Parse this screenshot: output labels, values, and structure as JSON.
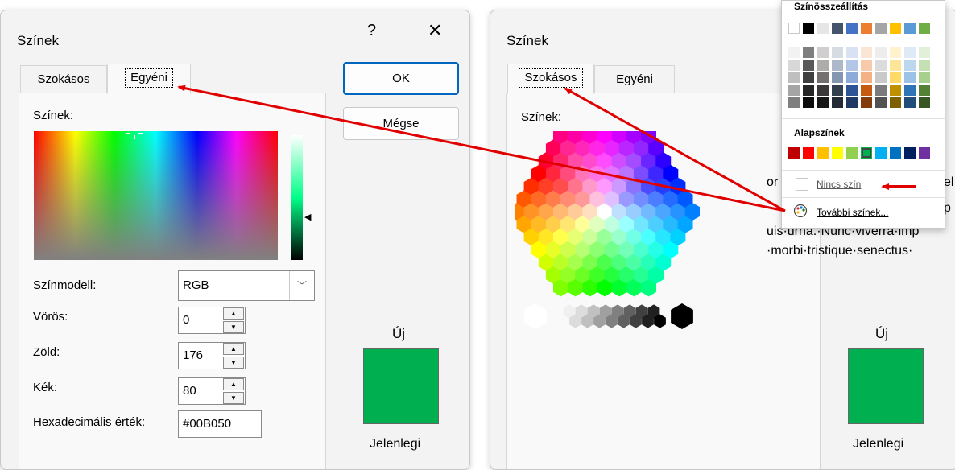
{
  "left_dialog": {
    "title": "Színek",
    "help_label": "?",
    "close_label": "✕",
    "tabs": [
      "Szokásos",
      "Egyéni"
    ],
    "colors_label": "Színek:",
    "ok_label": "OK",
    "cancel_label": "Mégse",
    "color_model_label": "Színmodell:",
    "color_model_value": "RGB",
    "red_label": "Vörös:",
    "red_value": "0",
    "green_label": "Zöld:",
    "green_value": "176",
    "blue_label": "Kék:",
    "blue_value": "80",
    "hex_label": "Hexadecimális érték:",
    "hex_value": "#00B050",
    "new_label": "Új",
    "current_label": "Jelenlegi",
    "swatch_color": "#00B050"
  },
  "right_dialog": {
    "title": "Színek",
    "tabs": [
      "Szokásos",
      "Egyéni"
    ],
    "colors_label": "Színek:",
    "new_label": "Új",
    "current_label": "Jelenlegi",
    "swatch_color": "#00B050"
  },
  "background_text": {
    "fragment_1": "or",
    "fragment_2": "el",
    "fragment_3": "p",
    "line_3": "uis·urna.·Nunc·viverra·imp",
    "line_4": "·morbi·tristique·senectus·"
  },
  "color_menu": {
    "theme_colors_heading": "Színösszeállítás",
    "standard_colors_heading": "Alapszínek",
    "no_color_label": "Nincs szín",
    "more_colors_label": "További színek...",
    "theme_colors_top": [
      "#FFFFFF",
      "#000000",
      "#E7E6E6",
      "#44546A",
      "#4472C4",
      "#ED7D31",
      "#A5A5A5",
      "#FFC000",
      "#5B9BD5",
      "#70AD47"
    ],
    "theme_shades": [
      [
        "#F2F2F2",
        "#7F7F7F",
        "#D0CECE",
        "#D6DCE4",
        "#D9E2F3",
        "#FBE5D5",
        "#EDEDED",
        "#FFF2CC",
        "#DEEBF6",
        "#E2EFD9"
      ],
      [
        "#D8D8D8",
        "#595959",
        "#AEABAB",
        "#ADB9CA",
        "#B4C6E7",
        "#F7CAAC",
        "#DBDBDB",
        "#FFE598",
        "#BDD7EE",
        "#C5E0B3"
      ],
      [
        "#BFBFBF",
        "#3F3F3F",
        "#757070",
        "#8496B0",
        "#8EAADB",
        "#F4B183",
        "#C9C9C9",
        "#FFD965",
        "#9CC3E5",
        "#A8D08D"
      ],
      [
        "#A5A5A5",
        "#262626",
        "#3A3838",
        "#323F4F",
        "#2F5496",
        "#C55A11",
        "#7B7B7B",
        "#BF9000",
        "#2E75B5",
        "#538135"
      ],
      [
        "#7F7F7F",
        "#0C0C0C",
        "#171616",
        "#222A35",
        "#1F3864",
        "#833C0B",
        "#525252",
        "#7F6000",
        "#1E4E79",
        "#375623"
      ]
    ],
    "standard_colors": [
      "#C00000",
      "#FF0000",
      "#FFC000",
      "#FFFF00",
      "#92D050",
      "#00B050",
      "#00B0F0",
      "#0070C0",
      "#002060",
      "#7030A0"
    ]
  },
  "annotation_color": "#E00000"
}
